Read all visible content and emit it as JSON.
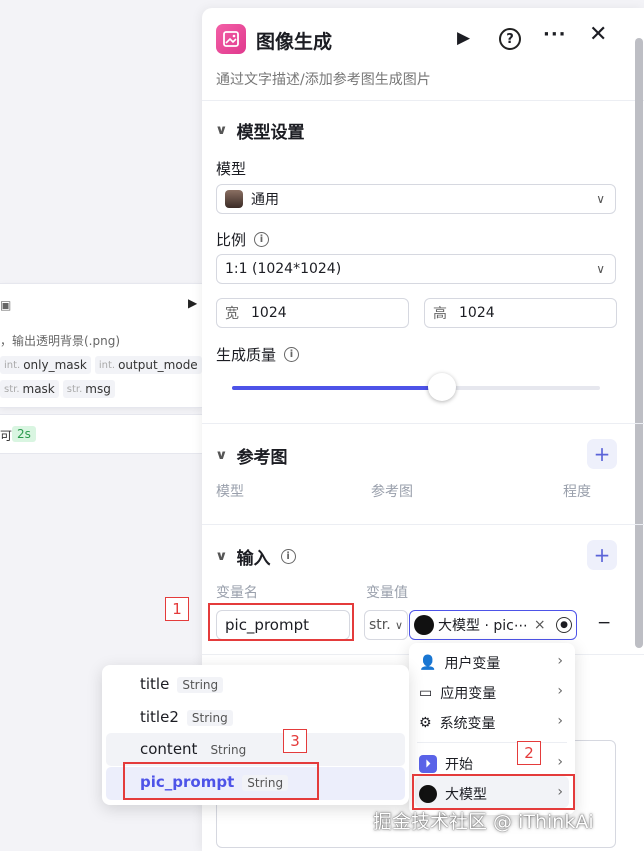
{
  "bg_node": {
    "desc": "，输出透明背景(.png)",
    "params": [
      {
        "type": "int.",
        "name": "only_mask"
      },
      {
        "type": "int.",
        "name": "output_mode"
      },
      {
        "type": "str.",
        "name": "mask"
      },
      {
        "type": "str.",
        "name": "msg"
      }
    ],
    "status_prefix": "可",
    "time_badge": "2s"
  },
  "header": {
    "title": "图像生成",
    "subtitle": "通过文字描述/添加参考图生成图片"
  },
  "model_section": {
    "title": "模型设置",
    "model_label": "模型",
    "model_value": "通用",
    "ratio_label": "比例",
    "ratio_value": "1:1 (1024*1024)",
    "width_label": "宽",
    "width_value": "1024",
    "height_label": "高",
    "height_value": "1024",
    "quality_label": "生成质量",
    "quality_fraction": 0.57
  },
  "ref_section": {
    "title": "参考图",
    "columns": [
      "模型",
      "参考图",
      "程度"
    ]
  },
  "input_section": {
    "title": "输入",
    "col_name": "变量名",
    "col_value": "变量值",
    "var_name": "pic_prompt",
    "type_short": "str.",
    "ref_value": "大模型 · pic⋯",
    "remove": "×",
    "minus": "−"
  },
  "source_menu": {
    "items": [
      {
        "label": "用户变量",
        "icon": "user-icon"
      },
      {
        "label": "应用变量",
        "icon": "folder-icon"
      },
      {
        "label": "系统变量",
        "icon": "gear-icon"
      },
      {
        "label": "开始",
        "icon": "start-icon"
      },
      {
        "label": "大模型",
        "icon": "llm-icon"
      }
    ]
  },
  "var_menu": {
    "items": [
      {
        "name": "title",
        "type": "String"
      },
      {
        "name": "title2",
        "type": "String"
      },
      {
        "name": "content",
        "type": "String"
      },
      {
        "name": "pic_prompt",
        "type": "String"
      }
    ]
  },
  "annotations": [
    "1",
    "2",
    "3"
  ],
  "watermark": "掘金技术社区 @ iThinkAi",
  "colors": {
    "accent": "#4d53e8",
    "annotation": "#e43b3b",
    "icon_pink": "#ee4fa0"
  }
}
